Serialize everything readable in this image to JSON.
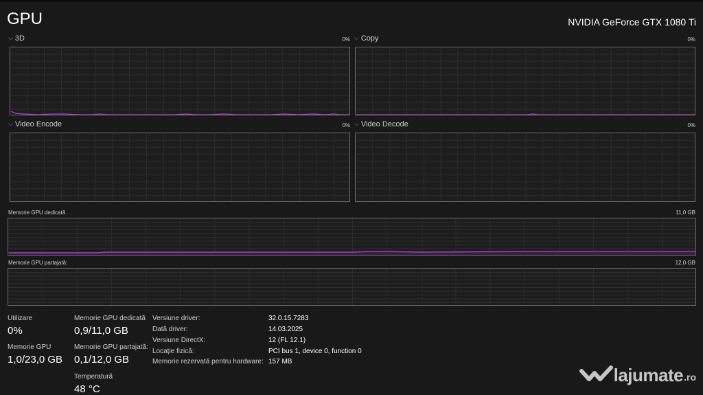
{
  "header": {
    "title": "GPU",
    "gpu_model": "NVIDIA GeForce GTX 1080 Ti"
  },
  "engines": [
    {
      "name": "3D",
      "percent": "0%"
    },
    {
      "name": "Copy",
      "percent": "0%"
    },
    {
      "name": "Video Encode",
      "percent": "0%"
    },
    {
      "name": "Video Decode",
      "percent": "0%"
    }
  ],
  "memory_graphs": {
    "dedicated": {
      "label": "Memorie GPU dedicată",
      "max": "11,0 GB"
    },
    "shared": {
      "label": "Memorie GPU partajată:",
      "max": "12,0 GB"
    }
  },
  "stats": {
    "utilization": {
      "label": "Utilizare",
      "value": "0%"
    },
    "gpu_memory": {
      "label": "Memorie GPU",
      "value": "1,0/23,0 GB"
    },
    "dedicated_memory": {
      "label": "Memorie GPU dedicată",
      "value": "0,9/11,0 GB"
    },
    "shared_memory": {
      "label": "Memorie GPU partajată:",
      "value": "0,1/12,0 GB"
    },
    "temperature": {
      "label": "Temperatură",
      "value": "48 °C"
    }
  },
  "info": [
    {
      "label": "Versiune driver:",
      "value": "32.0.15.7283"
    },
    {
      "label": "Dată driver:",
      "value": "14.03.2025"
    },
    {
      "label": "Versiune DirectX:",
      "value": "12 (FL 12.1)"
    },
    {
      "label": "Locație fizică:",
      "value": "PCI bus 1, device 0, function 0"
    },
    {
      "label": "Memorie rezervată pentru hardware:",
      "value": "157 MB"
    }
  ],
  "watermark": {
    "brand": "lajumate",
    "tld": ".ro"
  },
  "colors": {
    "background": "#191919",
    "graph_line": "#c040e0",
    "grid": "#2e2e2e",
    "border": "#6e6e6e"
  }
}
